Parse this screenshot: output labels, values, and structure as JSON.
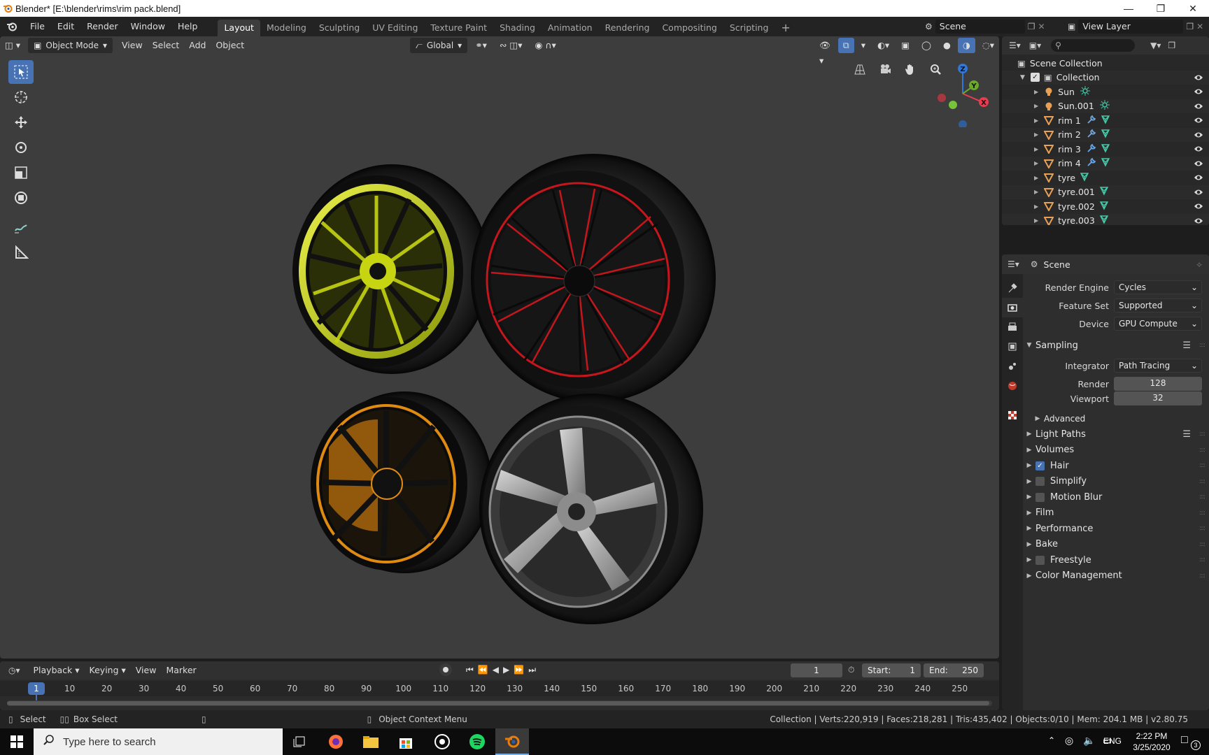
{
  "window": {
    "title": "Blender* [E:\\blender\\rims\\rim pack.blend]"
  },
  "menu": [
    "File",
    "Edit",
    "Render",
    "Window",
    "Help"
  ],
  "workspaces": [
    "Layout",
    "Modeling",
    "Sculpting",
    "UV Editing",
    "Texture Paint",
    "Shading",
    "Animation",
    "Rendering",
    "Compositing",
    "Scripting"
  ],
  "active_workspace": "Layout",
  "scene_name": "Scene",
  "view_layer": "View Layer",
  "viewport": {
    "mode": "Object Mode",
    "menus": [
      "View",
      "Select",
      "Add",
      "Object"
    ],
    "transform_orientation": "Global"
  },
  "gizmo": {
    "x": "X",
    "y": "Y",
    "z": "Z"
  },
  "outliner": {
    "root": "Scene Collection",
    "collection": "Collection",
    "items": [
      {
        "name": "Sun",
        "type": "light",
        "mods": [
          "light-data"
        ]
      },
      {
        "name": "Sun.001",
        "type": "light",
        "mods": [
          "light-data"
        ]
      },
      {
        "name": "rim 1",
        "type": "mesh",
        "mods": [
          "modifier",
          "mesh-data"
        ]
      },
      {
        "name": "rim 2",
        "type": "mesh",
        "mods": [
          "modifier",
          "mesh-data"
        ]
      },
      {
        "name": "rim 3",
        "type": "mesh",
        "mods": [
          "modifier",
          "mesh-data"
        ]
      },
      {
        "name": "rim 4",
        "type": "mesh",
        "mods": [
          "modifier",
          "mesh-data"
        ]
      },
      {
        "name": "tyre",
        "type": "mesh",
        "mods": [
          "mesh-data"
        ]
      },
      {
        "name": "tyre.001",
        "type": "mesh",
        "mods": [
          "mesh-data"
        ]
      },
      {
        "name": "tyre.002",
        "type": "mesh",
        "mods": [
          "mesh-data"
        ]
      },
      {
        "name": "tyre.003",
        "type": "mesh",
        "mods": [
          "mesh-data"
        ]
      }
    ]
  },
  "properties": {
    "context": "Scene",
    "render_engine_label": "Render Engine",
    "render_engine": "Cycles",
    "feature_set_label": "Feature Set",
    "feature_set": "Supported",
    "device_label": "Device",
    "device": "GPU Compute",
    "sampling": "Sampling",
    "integrator_label": "Integrator",
    "integrator": "Path Tracing",
    "render_label": "Render",
    "render_samples": "128",
    "viewport_label": "Viewport",
    "viewport_samples": "32",
    "advanced": "Advanced",
    "panels": [
      {
        "label": "Light Paths",
        "checkbox": null
      },
      {
        "label": "Volumes",
        "checkbox": null
      },
      {
        "label": "Hair",
        "checkbox": true
      },
      {
        "label": "Simplify",
        "checkbox": false
      },
      {
        "label": "Motion Blur",
        "checkbox": false
      },
      {
        "label": "Film",
        "checkbox": null
      },
      {
        "label": "Performance",
        "checkbox": null
      },
      {
        "label": "Bake",
        "checkbox": null
      },
      {
        "label": "Freestyle",
        "checkbox": false
      },
      {
        "label": "Color Management",
        "checkbox": null
      }
    ]
  },
  "timeline": {
    "menus": [
      "Playback",
      "Keying",
      "View",
      "Marker"
    ],
    "current_frame": "1",
    "start_label": "Start:",
    "start": "1",
    "end_label": "End:",
    "end": "250",
    "ticks": [
      "1",
      "10",
      "20",
      "30",
      "40",
      "50",
      "60",
      "70",
      "80",
      "90",
      "100",
      "110",
      "120",
      "130",
      "140",
      "150",
      "160",
      "170",
      "180",
      "190",
      "200",
      "210",
      "220",
      "230",
      "240",
      "250"
    ]
  },
  "statusbar": {
    "select": "Select",
    "box_select": "Box Select",
    "context_menu": "Object Context Menu",
    "stats": "Collection | Verts:220,919 | Faces:218,281 | Tris:435,402 | Objects:0/10 | Mem: 204.1 MB | v2.80.75"
  },
  "taskbar": {
    "search_placeholder": "Type here to search",
    "lang": "ENG",
    "time": "2:22 PM",
    "date": "3/25/2020",
    "notifications": "3"
  },
  "colors": {
    "accent": "#4772b3",
    "rim1": "#c6d411",
    "rim2": "#c4161c",
    "rim3": "#e08a10",
    "rim4": "#a8a8a8",
    "blender_orange": "#e87d0d"
  }
}
